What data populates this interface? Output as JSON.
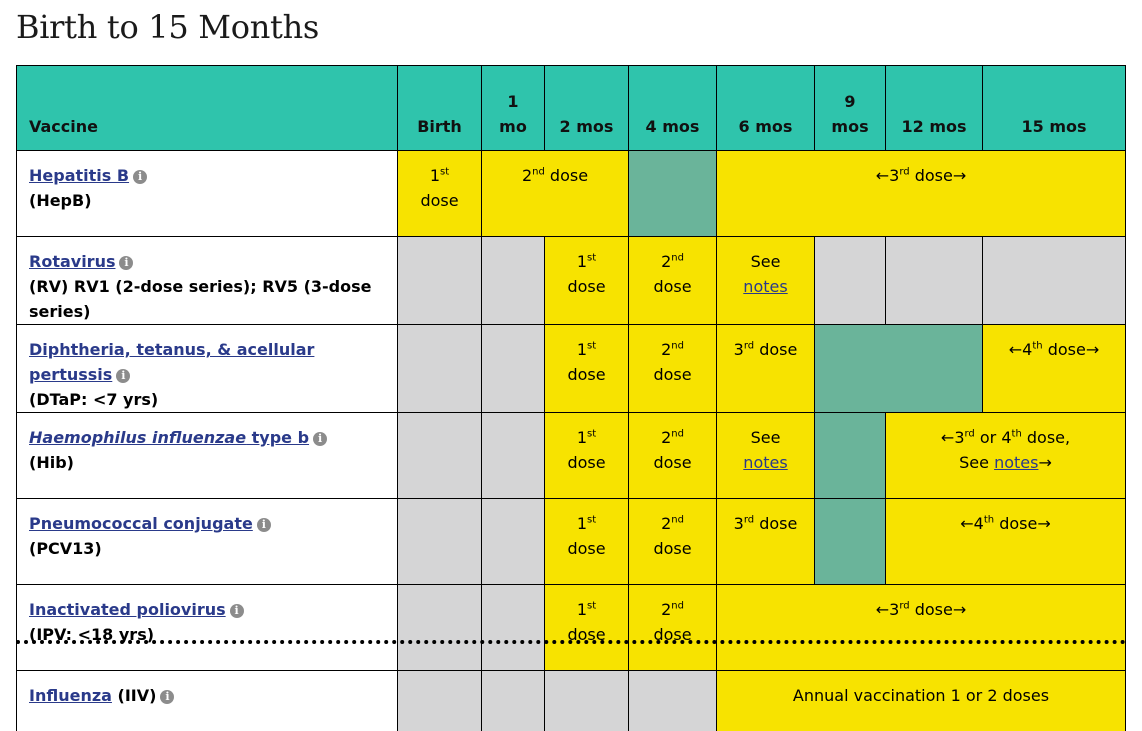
{
  "page": {
    "title": "Birth to 15 Months"
  },
  "header": {
    "vaccine": "Vaccine",
    "cols": [
      {
        "l1": "",
        "l2": "Birth"
      },
      {
        "l1": "1",
        "l2": "mo"
      },
      {
        "l1": "",
        "l2": "2 mos"
      },
      {
        "l1": "",
        "l2": "4 mos"
      },
      {
        "l1": "",
        "l2": "6 mos"
      },
      {
        "l1": "9",
        "l2": "mos"
      },
      {
        "l1": "",
        "l2": "12 mos"
      },
      {
        "l1": "",
        "l2": "15 mos"
      }
    ]
  },
  "labels": {
    "dose": "dose",
    "st": "st",
    "nd": "nd",
    "rd": "rd",
    "th": "th",
    "first": "1",
    "second": "2",
    "third": "3",
    "fourth": "4",
    "see": "See",
    "notes": "notes",
    "arrow_left": "←",
    "arrow_right": "→",
    "dose_space": " dose",
    "or": " or ",
    "dose_comma": " dose,",
    "see_space": "See ",
    "annual": "Annual vaccination 1 or 2 doses",
    "info": "i"
  },
  "rows": [
    {
      "name": "Hepatitis B",
      "abbr": "(HepB)"
    },
    {
      "name": "Rotavirus",
      "abbr": "(RV) RV1 (2-dose series); RV5 (3-dose series)"
    },
    {
      "name": "Diphtheria, tetanus, & acellular pertussis",
      "abbr": "(DTaP: <7 yrs)"
    },
    {
      "name_italic": "Haemophilus influenzae",
      "name_rest": " type b",
      "abbr": "(Hib)"
    },
    {
      "name": "Pneumococcal conjugate",
      "abbr": "(PCV13)"
    },
    {
      "name": "Inactivated poliovirus",
      "abbr": "(IPV: <18 yrs)"
    },
    {
      "name": "Influenza",
      "abbr_inline": " (IIV)"
    }
  ],
  "colors": {
    "header": "#2fc4ac",
    "yellow": "#f7e300",
    "gray": "#d5d5d6",
    "teal": "#6ab49a",
    "link": "#2a3a8a"
  }
}
